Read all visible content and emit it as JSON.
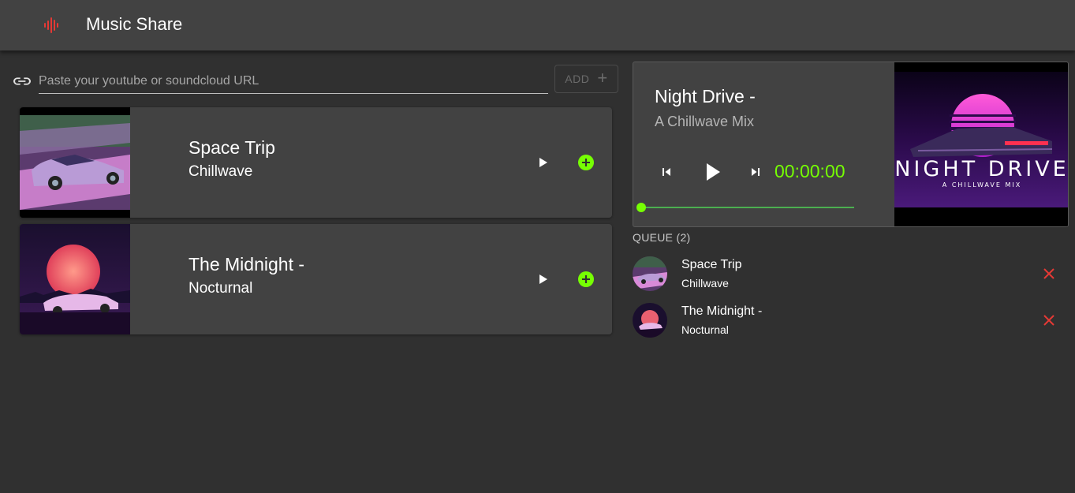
{
  "app": {
    "title": "Music Share",
    "accent_color": "#e53935",
    "icon": "audio-waveform-icon"
  },
  "url_input": {
    "placeholder": "Paste your youtube or soundcloud URL",
    "value": "",
    "icon": "link-icon"
  },
  "add_button": {
    "label": "ADD",
    "icon": "plus-icon",
    "enabled": false
  },
  "songs": [
    {
      "title": "Space Trip",
      "artist": "Chillwave",
      "thumbnail": "purple-sports-car-art",
      "play_icon": "play-icon",
      "add_icon": "add-circle-icon"
    },
    {
      "title": "The Midnight -",
      "artist": "Nocturnal",
      "thumbnail": "sunset-car-art",
      "play_icon": "play-icon",
      "add_icon": "add-circle-icon"
    }
  ],
  "player": {
    "title": "Night Drive -",
    "artist": "A Chillwave Mix",
    "time": "00:00:00",
    "progress": 0,
    "time_color": "#76ff03",
    "cover_art_text": "NIGHT DRIVE",
    "cover_art_subtext": "A CHILLWAVE MIX",
    "controls": [
      "skip-previous-icon",
      "play-icon",
      "skip-next-icon"
    ]
  },
  "queue": {
    "title": "QUEUE (2)",
    "items": [
      {
        "title": "Space Trip",
        "artist": "Chillwave",
        "remove_icon": "close-icon"
      },
      {
        "title": "The Midnight -",
        "artist": "Nocturnal",
        "remove_icon": "close-icon"
      }
    ]
  }
}
